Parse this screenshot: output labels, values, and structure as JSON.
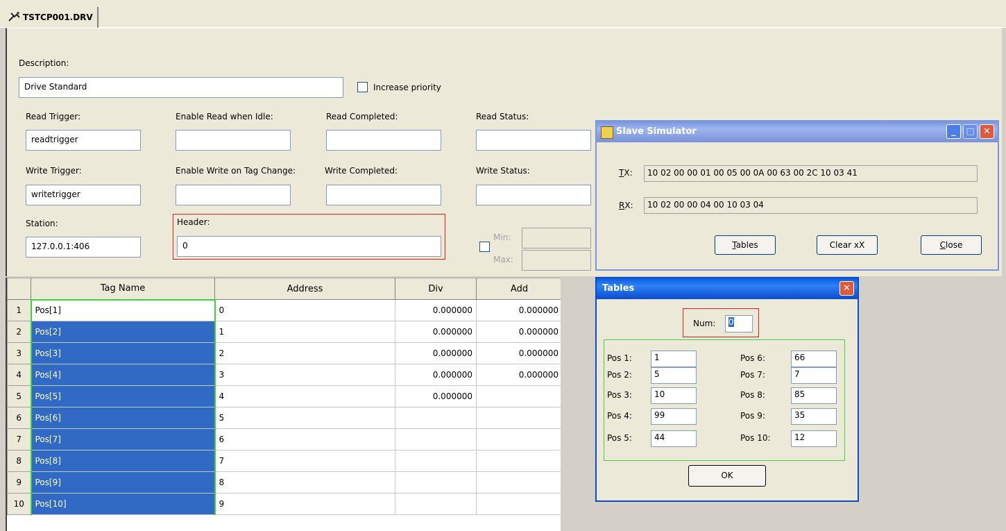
{
  "tab": {
    "title": "TSTCP001.DRV"
  },
  "form": {
    "description_label": "Description:",
    "description_value": "Drive Standard",
    "increase_priority": "Increase priority",
    "read_trigger_label": "Read Trigger:",
    "read_trigger_value": "readtrigger",
    "enable_read_label": "Enable Read when Idle:",
    "read_completed_label": "Read Completed:",
    "read_status_label": "Read Status:",
    "write_trigger_label": "Write Trigger:",
    "write_trigger_value": "writetrigger",
    "enable_write_label": "Enable Write on Tag Change:",
    "write_completed_label": "Write Completed:",
    "write_status_label": "Write Status:",
    "station_label": "Station:",
    "station_value": "127.0.0.1:406",
    "header_label": "Header:",
    "header_value": "0",
    "min_label": "Min:",
    "max_label": "Max:"
  },
  "grid": {
    "columns": [
      "Tag Name",
      "Address",
      "Div",
      "Add"
    ],
    "rows": [
      {
        "n": "1",
        "tag": "Pos[1]",
        "address": "0",
        "div": "0.000000",
        "add": "0.000000"
      },
      {
        "n": "2",
        "tag": "Pos[2]",
        "address": "1",
        "div": "0.000000",
        "add": "0.000000"
      },
      {
        "n": "3",
        "tag": "Pos[3]",
        "address": "2",
        "div": "0.000000",
        "add": "0.000000"
      },
      {
        "n": "4",
        "tag": "Pos[4]",
        "address": "3",
        "div": "0.000000",
        "add": "0.000000"
      },
      {
        "n": "5",
        "tag": "Pos[5]",
        "address": "4",
        "div": "0.000000",
        "add": ""
      },
      {
        "n": "6",
        "tag": "Pos[6]",
        "address": "5",
        "div": "",
        "add": ""
      },
      {
        "n": "7",
        "tag": "Pos[7]",
        "address": "6",
        "div": "",
        "add": ""
      },
      {
        "n": "8",
        "tag": "Pos[8]",
        "address": "7",
        "div": "",
        "add": ""
      },
      {
        "n": "9",
        "tag": "Pos[9]",
        "address": "8",
        "div": "",
        "add": ""
      },
      {
        "n": "10",
        "tag": "Pos[10]",
        "address": "9",
        "div": "",
        "add": ""
      }
    ]
  },
  "simulator": {
    "title": "Slave Simulator",
    "tx_label": "TX:",
    "tx_value": "10 02 00 00 01 00 05 00 0A 00 63 00 2C 10 03 41",
    "rx_label": "RX:",
    "rx_value": "10 02 00 00 04 00 10 03 04",
    "tables_button": "Tables",
    "clear_button": "Clear xX",
    "close_button": "Close"
  },
  "tables": {
    "title": "Tables",
    "num_label": "Num:",
    "num_value": "0",
    "left": [
      {
        "label": "Pos 1:",
        "value": "1"
      },
      {
        "label": "Pos 2:",
        "value": "5"
      },
      {
        "label": "Pos 3:",
        "value": "10"
      },
      {
        "label": "Pos 4:",
        "value": "99"
      },
      {
        "label": "Pos 5:",
        "value": "44"
      }
    ],
    "right": [
      {
        "label": "Pos 6:",
        "value": "66"
      },
      {
        "label": "Pos 7:",
        "value": "7"
      },
      {
        "label": "Pos 8:",
        "value": "85"
      },
      {
        "label": "Pos 9:",
        "value": "35"
      },
      {
        "label": "Pos 10:",
        "value": "12"
      }
    ],
    "ok_button": "OK"
  }
}
